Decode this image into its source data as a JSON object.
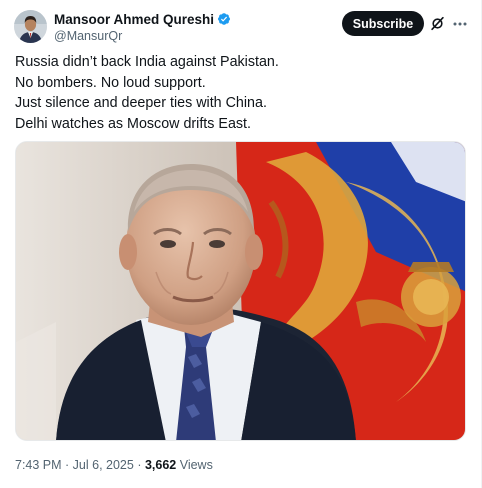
{
  "author": {
    "display_name": "Mansoor Ahmed Qureshi",
    "handle": "@MansurQr",
    "verified": true
  },
  "actions": {
    "subscribe_label": "Subscribe",
    "grok_icon": "grok-icon",
    "more_icon": "more-icon"
  },
  "tweet": {
    "lines": [
      "Russia didn’t back India against Pakistan.",
      "No bombers. No loud support.",
      "Just silence and deeper ties with China.",
      "Delhi watches as Moscow drifts East."
    ]
  },
  "media": {
    "type": "photo"
  },
  "meta": {
    "time": "7:43 PM",
    "separator": " · ",
    "date": "Jul 6, 2025",
    "views_count": "3,662",
    "views_label": " Views"
  },
  "colors": {
    "text": "#0f1419",
    "secondary": "#536471",
    "verified_blue": "#1d9bf0",
    "button_bg": "#0f1419",
    "flag_red": "#d62718",
    "flag_blue": "#1f3fa8",
    "emblem_gold": "#e0a63a"
  }
}
